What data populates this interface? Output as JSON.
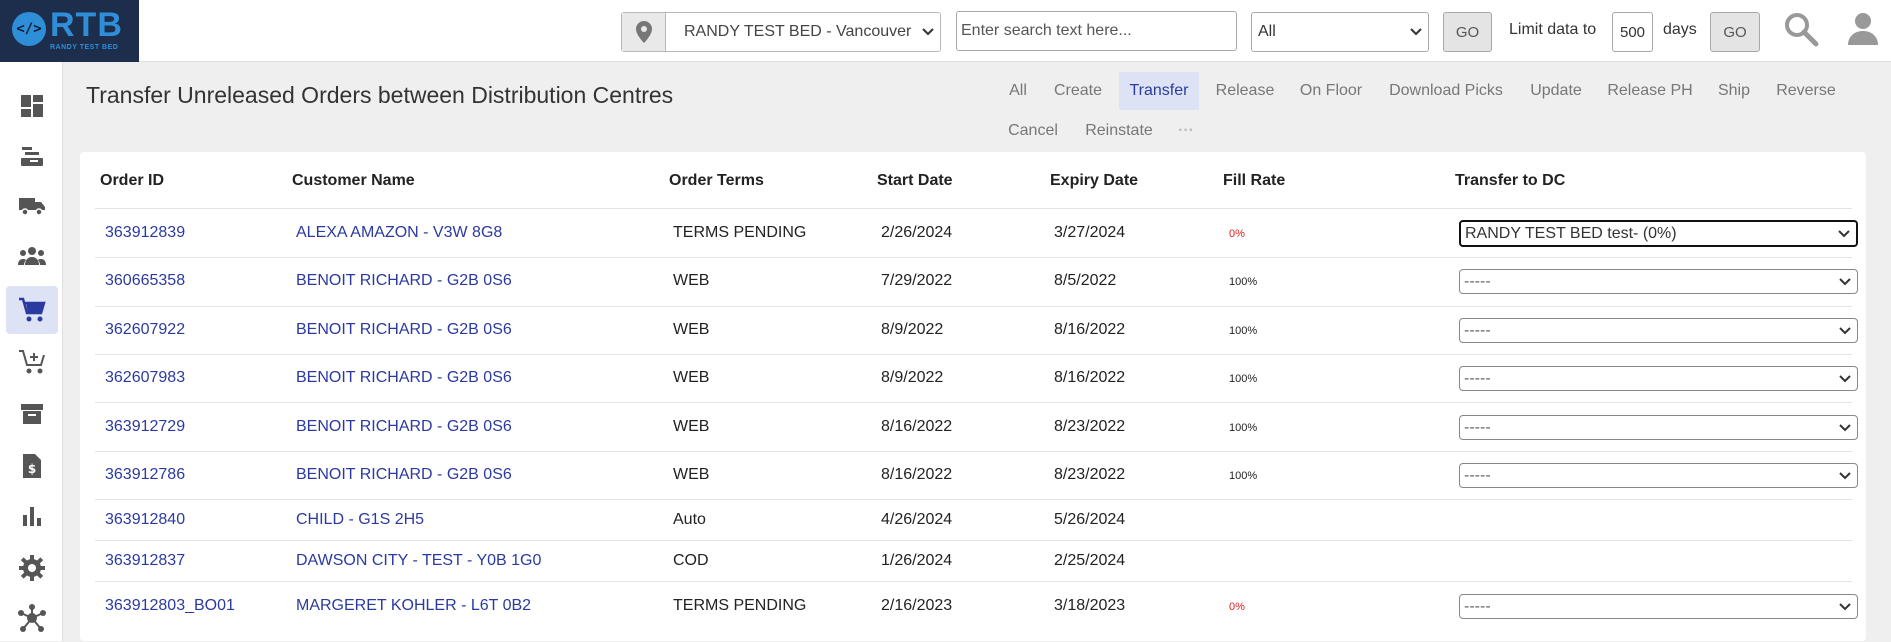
{
  "brand": {
    "name": "RTB",
    "subtitle": "RANDY TEST BED",
    "badge": "</>"
  },
  "header": {
    "location": "RANDY TEST BED - Vancouver",
    "search_placeholder": "Enter search text here...",
    "filter_value": "All",
    "go_label": "GO",
    "limit_label": "Limit data to",
    "limit_value": "500",
    "days_label": "days",
    "go2_label": "GO"
  },
  "sidebar": {
    "items": [
      {
        "icon": "dashboard-icon",
        "active": false
      },
      {
        "icon": "receiving-icon",
        "active": false
      },
      {
        "icon": "truck-icon",
        "active": false
      },
      {
        "icon": "users-icon",
        "active": false
      },
      {
        "icon": "cart-icon",
        "active": true
      },
      {
        "icon": "cart-add-icon",
        "active": false
      },
      {
        "icon": "archive-icon",
        "active": false
      },
      {
        "icon": "invoice-icon",
        "active": false
      },
      {
        "icon": "bar-chart-icon",
        "active": false
      },
      {
        "icon": "gear-icon",
        "active": false
      },
      {
        "icon": "hub-icon",
        "active": false
      }
    ]
  },
  "page": {
    "title": "Transfer Unreleased Orders between Distribution Centres"
  },
  "tabs": [
    "All",
    "Create",
    "Transfer",
    "Release",
    "On Floor",
    "Download Picks",
    "Update",
    "Release PH",
    "Ship",
    "Reverse",
    "Cancel",
    "Reinstate",
    "···"
  ],
  "active_tab": "Transfer",
  "table": {
    "headers": [
      "Order ID",
      "Customer Name",
      "Order Terms",
      "Start Date",
      "Expiry Date",
      "Fill Rate",
      "Transfer to DC"
    ],
    "rows": [
      {
        "id": "363912839",
        "customer": "ALEXA AMAZON - V3W 8G8",
        "terms": "TERMS PENDING",
        "start": "2/26/2024",
        "expiry": "3/27/2024",
        "fill": "0%",
        "dc": "RANDY TEST BED test- (0%)"
      },
      {
        "id": "360665358",
        "customer": "BENOIT RICHARD - G2B 0S6",
        "terms": "WEB",
        "start": "7/29/2022",
        "expiry": "8/5/2022",
        "fill": "100%",
        "dc": "-----"
      },
      {
        "id": "362607922",
        "customer": "BENOIT RICHARD - G2B 0S6",
        "terms": "WEB",
        "start": "8/9/2022",
        "expiry": "8/16/2022",
        "fill": "100%",
        "dc": "-----"
      },
      {
        "id": "362607983",
        "customer": "BENOIT RICHARD - G2B 0S6",
        "terms": "WEB",
        "start": "8/9/2022",
        "expiry": "8/16/2022",
        "fill": "100%",
        "dc": "-----"
      },
      {
        "id": "363912729",
        "customer": "BENOIT RICHARD - G2B 0S6",
        "terms": "WEB",
        "start": "8/16/2022",
        "expiry": "8/23/2022",
        "fill": "100%",
        "dc": "-----"
      },
      {
        "id": "363912786",
        "customer": "BENOIT RICHARD - G2B 0S6",
        "terms": "WEB",
        "start": "8/16/2022",
        "expiry": "8/23/2022",
        "fill": "100%",
        "dc": "-----"
      },
      {
        "id": "363912840",
        "customer": "CHILD - G1S 2H5",
        "terms": "Auto",
        "start": "4/26/2024",
        "expiry": "5/26/2024",
        "fill": "",
        "dc": ""
      },
      {
        "id": "363912837",
        "customer": "DAWSON CITY - TEST - Y0B 1G0",
        "terms": "COD",
        "start": "1/26/2024",
        "expiry": "2/25/2024",
        "fill": "",
        "dc": ""
      },
      {
        "id": "363912803_BO01",
        "customer": "MARGERET KOHLER - L6T 0B2",
        "terms": "TERMS PENDING",
        "start": "2/16/2023",
        "expiry": "3/18/2023",
        "fill": "0%",
        "dc": "-----"
      }
    ]
  },
  "colors": {
    "link": "#2b3aa0",
    "accent_bg": "#dde2f5",
    "fill_zero": "#e02020",
    "brand_bg": "#1d2d4c",
    "brand_fg": "#2e8fd8"
  }
}
